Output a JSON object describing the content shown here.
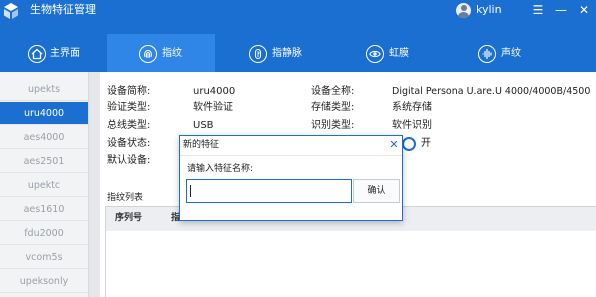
{
  "app": {
    "title": "生物特征管理",
    "username": "kylin",
    "controls": {
      "menu": "☰",
      "minimize": "—",
      "close": "✕"
    }
  },
  "nav": {
    "tabs": [
      {
        "label": "主界面",
        "icon": "home-icon"
      },
      {
        "label": "指纹",
        "icon": "fingerprint-icon",
        "active": true
      },
      {
        "label": "指静脉",
        "icon": "finger-vein-icon"
      },
      {
        "label": "虹膜",
        "icon": "eye-icon"
      },
      {
        "label": "声纹",
        "icon": "voiceprint-icon"
      }
    ]
  },
  "sidebar": {
    "items": [
      "upekts",
      "uru4000",
      "aes4000",
      "aes2501",
      "upektc",
      "aes1610",
      "fdu2000",
      "vcom5s",
      "upeksonly"
    ],
    "active_index": 1
  },
  "details": {
    "short_name_label": "设备简称:",
    "short_name_value": "uru4000",
    "full_name_label": "设备全称:",
    "full_name_value": "Digital Persona U.are.U 4000/4000B/4500",
    "verify_type_label": "验证类型:",
    "verify_type_value": "软件验证",
    "storage_type_label": "存储类型:",
    "storage_type_value": "系统存储",
    "bus_type_label": "总线类型:",
    "bus_type_value": "USB",
    "identify_type_label": "识别类型:",
    "identify_type_value": "软件识别",
    "status_label": "设备状态:",
    "status_toggle_label": "开",
    "default_label": "默认设备:"
  },
  "list": {
    "title": "指纹列表",
    "columns": [
      "序列号",
      "指"
    ]
  },
  "dialog": {
    "title": "新的特征",
    "prompt": "请输入特征名称:",
    "input_value": "",
    "confirm": "确认",
    "close": "✕"
  },
  "colors": {
    "brand_blue": "#1a6fd1",
    "active_tab": "#2f86e6",
    "sidebar_bg": "#f2f3f5"
  }
}
